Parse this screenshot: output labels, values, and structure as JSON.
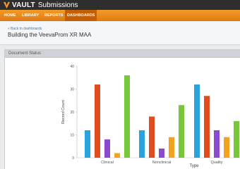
{
  "header": {
    "brand_vault": "VAULT",
    "brand_app": "Submissions",
    "logo_icon": "vault-v-logo-icon"
  },
  "nav": {
    "items": [
      {
        "label": "HOME"
      },
      {
        "label": "LIBRARY"
      },
      {
        "label": "REPORTS"
      },
      {
        "label": "DASHBOARDS"
      }
    ],
    "active": "DASHBOARDS"
  },
  "breadcrumb": {
    "back_label": "« Back to dashboards",
    "title": "Building the VeevaProm XR MAA"
  },
  "panel": {
    "title": "Document Status"
  },
  "colors": {
    "nav_orange": "#e98a1a",
    "nav_active": "#c25e04",
    "link_blue": "#2a7fc6",
    "series": [
      "#2aa3dc",
      "#e04b1f",
      "#8c4ad0",
      "#f2a21e",
      "#76c83a"
    ]
  },
  "chart_data": {
    "type": "bar",
    "xlabel": "Type",
    "ylabel": "Record Count",
    "ylim": [
      0,
      40
    ],
    "yticks": [
      0,
      10,
      20,
      30,
      40
    ],
    "grid": false,
    "categories": [
      "Clinical",
      "Nonclinical",
      "Quality"
    ],
    "series": [
      {
        "color": "#2aa3dc",
        "values": [
          12,
          12,
          32
        ]
      },
      {
        "color": "#e04b1f",
        "values": [
          32,
          18,
          27
        ]
      },
      {
        "color": "#8c4ad0",
        "values": [
          8,
          4,
          12
        ]
      },
      {
        "color": "#f2a21e",
        "values": [
          2,
          9,
          9
        ]
      },
      {
        "color": "#76c83a",
        "values": [
          36,
          23,
          16
        ]
      }
    ]
  }
}
